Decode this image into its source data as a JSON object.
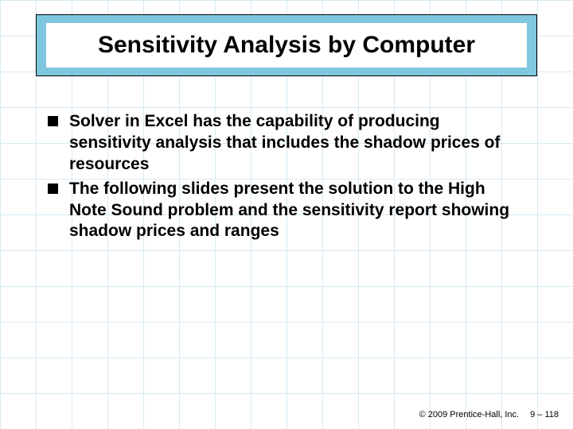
{
  "title": "Sensitivity Analysis by Computer",
  "bullets": [
    "Solver in Excel has the capability of producing sensitivity analysis that includes the shadow prices of resources",
    "The following slides present the solution to the High Note Sound problem and the sensitivity report showing shadow prices and ranges"
  ],
  "footer": {
    "copyright": "© 2009 Prentice-Hall, Inc.",
    "page": "9 – 118"
  }
}
